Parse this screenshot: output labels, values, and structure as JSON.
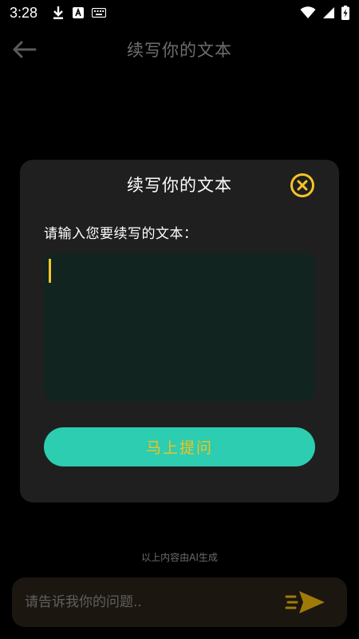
{
  "status_bar": {
    "time": "3:28",
    "icons": [
      "download-icon",
      "a-badge-icon",
      "keyboard-icon",
      "wifi-icon",
      "signal-icon",
      "battery-charging-icon"
    ]
  },
  "header": {
    "back_icon": "arrow-left-icon",
    "title": "续写你的文本"
  },
  "modal": {
    "title": "续写你的文本",
    "close_icon": "close-circle-icon",
    "label": "请输入您要续写的文本：",
    "textarea_value": "",
    "submit_label": "马上提问"
  },
  "footer": {
    "ai_notice": "以上内容由AI生成",
    "chat_placeholder": "请告诉我你的问题..",
    "send_icon": "send-icon"
  },
  "colors": {
    "accent_yellow": "#f4c42a",
    "button_teal": "#2dcdb1",
    "modal_bg": "#1f1f1f",
    "textarea_bg": "#12241f",
    "page_bg": "#000000"
  }
}
